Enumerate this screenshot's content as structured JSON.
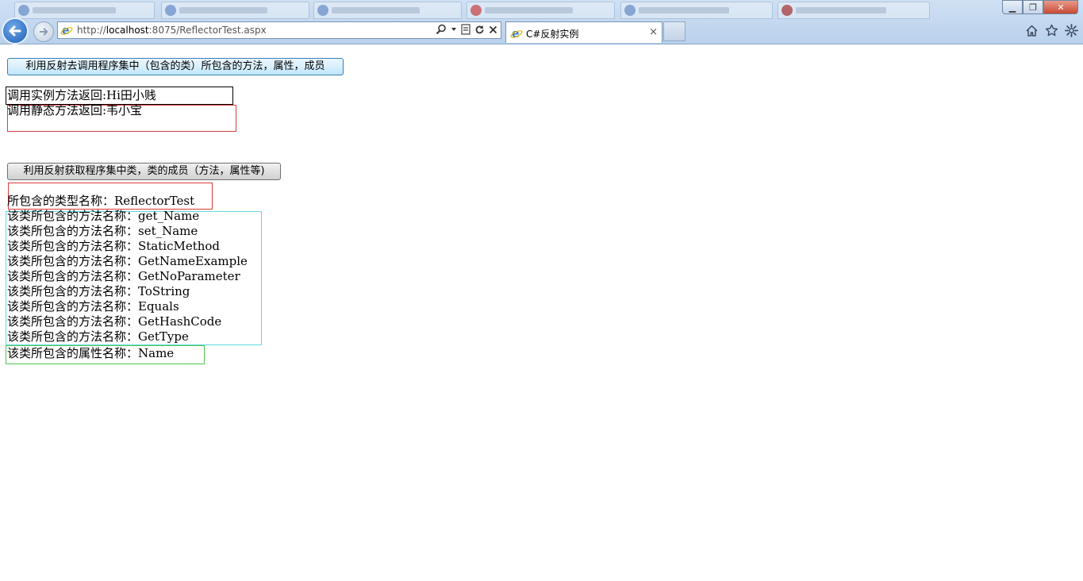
{
  "browser": {
    "window_controls": {
      "minimize": "▁",
      "restore": "❐",
      "close": "✕"
    },
    "address_bar": {
      "url_prefix": "http://",
      "url_host": "localhost",
      "url_rest": ":8075/ReflectorTest.aspx"
    },
    "active_tab": {
      "title": "C#反射实例",
      "close": "×"
    },
    "icons": [
      "back-arrow-icon",
      "forward-arrow-icon",
      "ie-icon",
      "search-icon",
      "compat-view-icon",
      "refresh-icon",
      "stop-icon",
      "home-icon",
      "favorites-star-icon",
      "settings-gear-icon"
    ]
  },
  "page": {
    "button_invoke": "利用反射去调用程序集中（包含的类）所包含的方法，属性，成员",
    "instance_result": "调用实例方法返回:Hi田小贱",
    "static_result": "调用静态方法返回:韦小宝",
    "button_members": "利用反射获取程序集中类，类的成员（方法，属性等)",
    "type_name": "所包含的类型名称：ReflectorTest",
    "methods": [
      "该类所包含的方法名称：get_Name",
      "该类所包含的方法名称：set_Name",
      "该类所包含的方法名称：StaticMethod",
      "该类所包含的方法名称：GetNameExample",
      "该类所包含的方法名称：GetNoParameter",
      "该类所包含的方法名称：ToString",
      "该类所包含的方法名称：Equals",
      "该类所包含的方法名称：GetHashCode",
      "该类所包含的方法名称：GetType"
    ],
    "property": "该类所包含的属性名称：Name",
    "colors": {
      "red_border": "#d83c3c",
      "cyan_border": "#5fd8e0",
      "green_border": "#52c552"
    }
  }
}
